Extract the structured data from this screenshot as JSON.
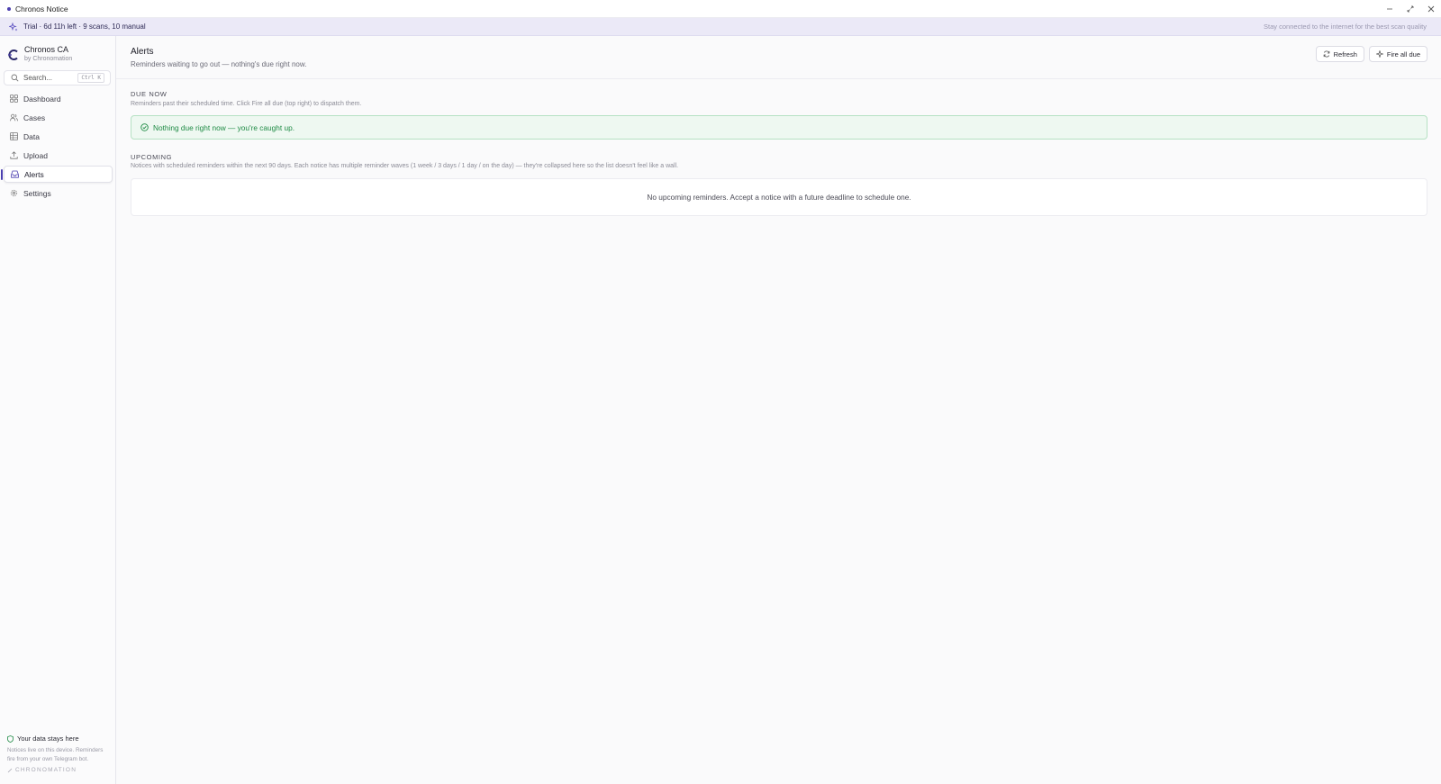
{
  "window": {
    "title": "Chronos Notice",
    "controls": [
      "minimize-icon",
      "restore-icon",
      "close-icon"
    ]
  },
  "trial_bar": {
    "text": "Trial · 6d 11h left · 9 scans, 10 manual",
    "hint": "Stay connected to the internet for the best scan quality"
  },
  "sidebar": {
    "brand_name": "Chronos CA",
    "brand_sub": "by Chronomation",
    "search_placeholder": "Search...",
    "search_shortcut": "Ctrl K",
    "items": [
      {
        "label": "Dashboard",
        "icon": "dashboard-icon"
      },
      {
        "label": "Cases",
        "icon": "users-icon"
      },
      {
        "label": "Data",
        "icon": "table-icon"
      },
      {
        "label": "Upload",
        "icon": "upload-icon"
      },
      {
        "label": "Alerts",
        "icon": "inbox-icon",
        "active": true
      },
      {
        "label": "Settings",
        "icon": "gear-icon"
      }
    ],
    "privacy_title": "Your data stays here",
    "privacy_body": "Notices live on this device. Reminders fire from your own Telegram bot.",
    "footer_brand": "CHRONOMATION"
  },
  "main": {
    "title": "Alerts",
    "subtitle": "Reminders waiting to go out — nothing's due right now.",
    "refresh_label": "Refresh",
    "fire_label": "Fire all due",
    "due_now": {
      "label": "DUE NOW",
      "description": "Reminders past their scheduled time. Click Fire all due (top right) to dispatch them.",
      "empty_message": "Nothing due right now — you're caught up."
    },
    "upcoming": {
      "label": "UPCOMING",
      "description": "Notices with scheduled reminders within the next 90 days. Each notice has multiple reminder waves (1 week / 3 days / 1 day / on the day) — they're collapsed here so the list doesn't feel like a wall.",
      "empty_message": "No upcoming reminders. Accept a notice with a future deadline to schedule one."
    }
  },
  "colors": {
    "accent": "#4b3fb0",
    "success_text": "#1f8b45",
    "success_bg": "#eef8f1",
    "trial_bg": "#ebe9f7"
  }
}
